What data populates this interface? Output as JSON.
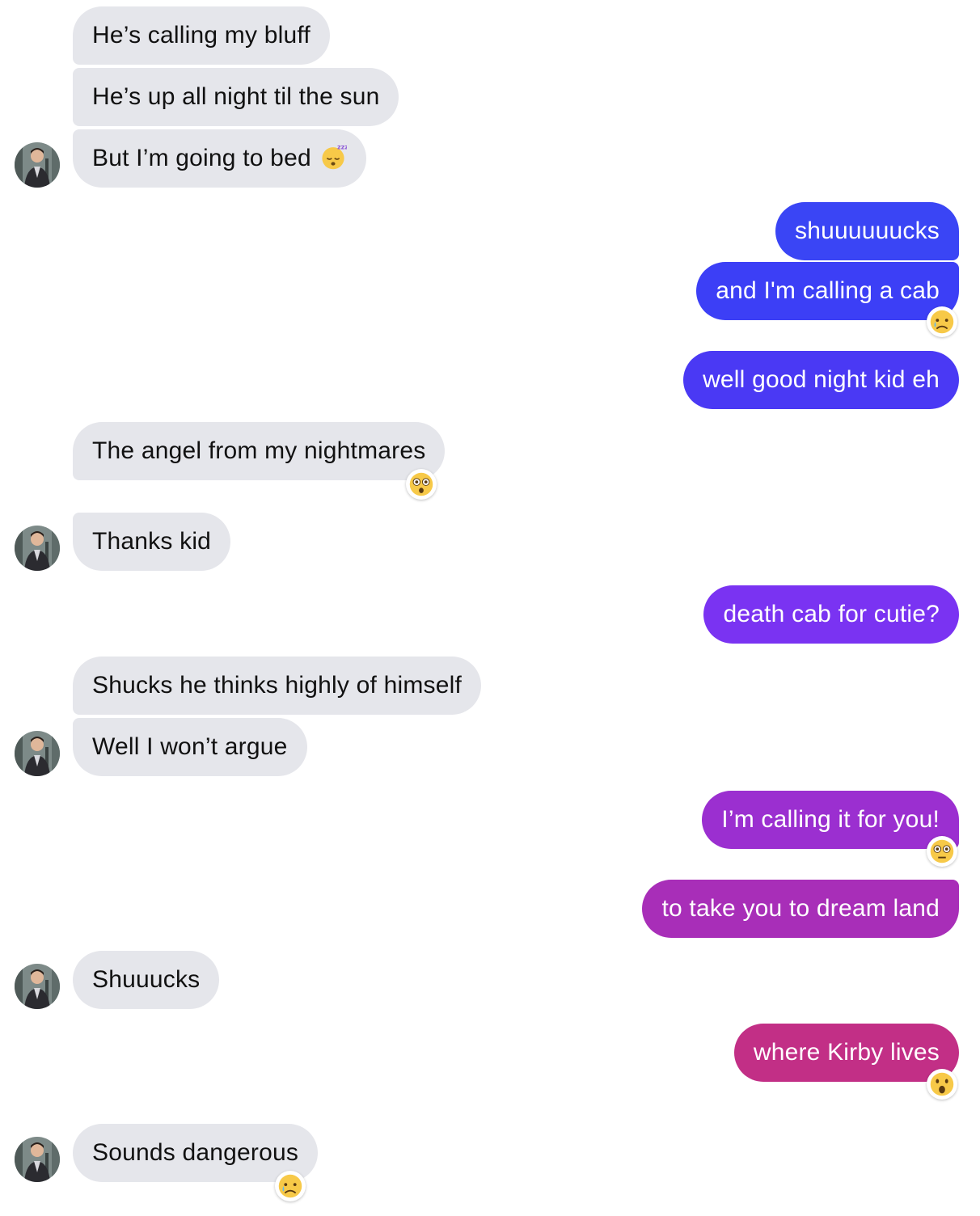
{
  "messages": [
    {
      "text": "He’s calling my bluff"
    },
    {
      "text": "He’s up all night til the sun"
    },
    {
      "text": "But I’m going to bed",
      "emoji": "sleeping-face-icon"
    },
    {
      "text": "shuuuuuucks",
      "color": "#3a45f5"
    },
    {
      "text": "and I'm calling a cab",
      "color": "#3c3ff6",
      "reaction": "sad-tear-face-icon"
    },
    {
      "text": "well good night kid eh",
      "color": "#4a39f4"
    },
    {
      "text": "The angel from my nightmares",
      "reaction": "flushed-face-icon"
    },
    {
      "text": "Thanks kid"
    },
    {
      "text": "death cab for cutie?",
      "color": "#7a33f2"
    },
    {
      "text": "Shucks he thinks highly of himself"
    },
    {
      "text": "Well I won’t argue"
    },
    {
      "text": "I’m calling it for you!",
      "color": "#9b2fd0",
      "reaction": "flushed-face-icon"
    },
    {
      "text": "to take you to dream land",
      "color": "#a82eb8"
    },
    {
      "text": "Shuuucks"
    },
    {
      "text": "where Kirby lives",
      "color": "#c22f86",
      "reaction": "astonished-face-icon"
    },
    {
      "text": "Sounds dangerous",
      "reaction": "sad-tear-face-icon"
    }
  ]
}
